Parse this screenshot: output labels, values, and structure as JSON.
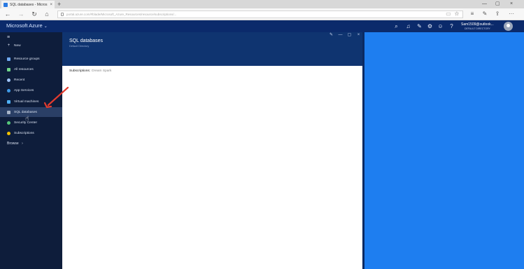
{
  "browser": {
    "tab_title": "SQL databases - Micros",
    "tab_close": "×",
    "new_tab": "+",
    "window_controls": [
      "—",
      "▢",
      "×"
    ],
    "address_url": "portal.azure.com/#blade/Microsoft_Azure_Resources/resource/subscriptions/...",
    "nav": {
      "back": "←",
      "forward": "→",
      "refresh": "↻",
      "home": "⌂"
    }
  },
  "azure": {
    "brand": "Microsoft Azure",
    "brand_chevron": "⌄",
    "header_icons": [
      "search-icon",
      "bell-icon",
      "pencil-icon",
      "gear-icon",
      "smiley-icon",
      "help-icon"
    ],
    "user_name": "Sam1509@outlook...",
    "user_sub": "DEFAULT DIRECTORY"
  },
  "sidebar": {
    "hamburger": "≡",
    "items": [
      {
        "label": "New",
        "icon": "+",
        "color": "#d8e0ef"
      },
      {
        "label": "Resource groups",
        "icon": "",
        "color": "#6fa8f0"
      },
      {
        "label": "All resources",
        "icon": "",
        "color": "#6fd48a"
      },
      {
        "label": "Recent",
        "icon": "",
        "color": "#9fc5f8"
      },
      {
        "label": "App Services",
        "icon": "",
        "color": "#3f9be8"
      },
      {
        "label": "Virtual machines",
        "icon": "",
        "color": "#4fb0f5"
      },
      {
        "label": "SQL databases",
        "icon": "",
        "color": "#a7b4c8"
      },
      {
        "label": "Security Center",
        "icon": "",
        "color": "#55c77a"
      },
      {
        "label": "Subscriptions",
        "icon": "",
        "color": "#f2c200"
      }
    ],
    "active_index": 6,
    "browse": "Browse",
    "browse_chevron": "›"
  },
  "blade": {
    "title": "SQL databases",
    "subtitle": "Default Directory",
    "controls": [
      "✎",
      "—",
      "▢",
      "×"
    ],
    "subscriptions_label": "Subscriptions:",
    "subscriptions_value": "Dream Spark"
  },
  "colors": {
    "header": "#0b2a6b",
    "sidebar": "#0e1d3b",
    "blade_header": "#0f3470",
    "right_panel": "#1e7ef0",
    "annotation": "#e23b2e"
  }
}
